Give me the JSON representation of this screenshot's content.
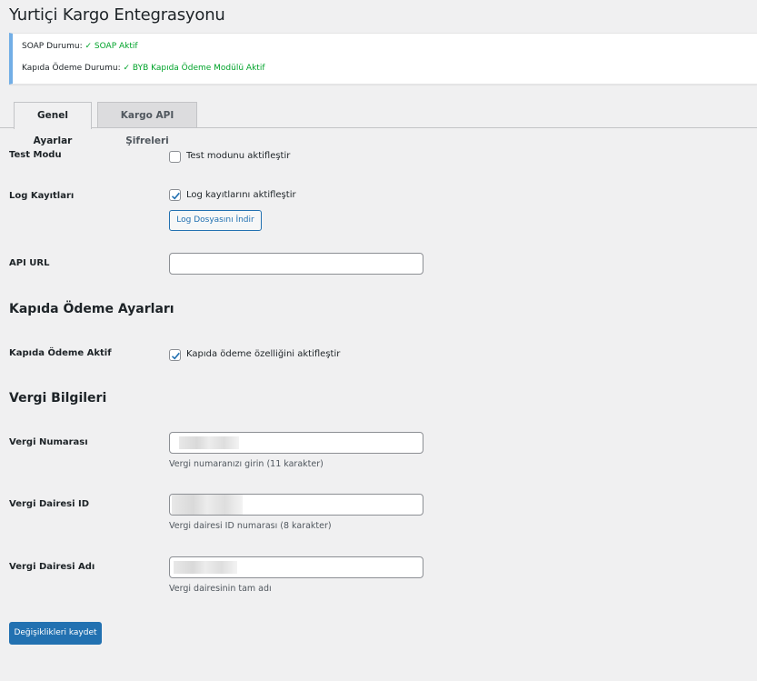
{
  "page": {
    "title": "Yurtiçi Kargo Entegrasyonu"
  },
  "notice": {
    "soap_label": "SOAP Durumu:",
    "soap_value": "✓ SOAP Aktif",
    "cod_label": "Kapıda Ödeme Durumu:",
    "cod_value": "✓ BYB Kapıda Ödeme Modülü Aktif",
    "status_color": "#00a32a"
  },
  "tabs": [
    {
      "label": "Genel Ayarlar",
      "active": true
    },
    {
      "label": "Kargo API Şifreleri",
      "active": false
    }
  ],
  "fields": {
    "test_mode": {
      "label": "Test Modu",
      "checkbox_label": "Test modunu aktifleştir",
      "checked": false
    },
    "log": {
      "label": "Log Kayıtları",
      "checkbox_label": "Log kayıtlarını aktifleştir",
      "checked": true,
      "button_label": "Log Dosyasını İndir"
    },
    "api_url": {
      "label": "API URL",
      "value": ""
    },
    "cod_section_title": "Kapıda Ödeme Ayarları",
    "cod_active": {
      "label": "Kapıda Ödeme Aktif",
      "checkbox_label": "Kapıda ödeme özelliğini aktifleştir",
      "checked": true
    },
    "tax_section_title": "Vergi Bilgileri",
    "tax_number": {
      "label": "Vergi Numarası",
      "description": "Vergi numaranızı girin (11 karakter)"
    },
    "tax_office_id": {
      "label": "Vergi Dairesi ID",
      "description": "Vergi dairesi ID numarası (8 karakter)"
    },
    "tax_office_name": {
      "label": "Vergi Dairesi Adı",
      "description": "Vergi dairesinin tam adı"
    }
  },
  "actions": {
    "save_label": "Değişiklikleri kaydet"
  },
  "colors": {
    "accent": "#2271b1",
    "checkbox_check": "#2271b1"
  }
}
